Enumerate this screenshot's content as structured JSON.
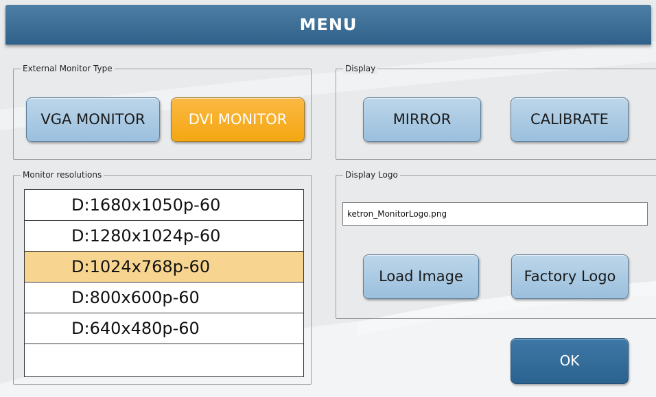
{
  "header": {
    "title": "MENU"
  },
  "external_monitor": {
    "legend": "External Monitor Type",
    "vga_label": "VGA MONITOR",
    "dvi_label": "DVI MONITOR",
    "selected": "DVI MONITOR"
  },
  "display": {
    "legend": "Display",
    "mirror_label": "MIRROR",
    "calibrate_label": "CALIBRATE"
  },
  "resolutions": {
    "legend": "Monitor resolutions",
    "items": [
      "D:1680x1050p-60",
      "D:1280x1024p-60",
      "D:1024x768p-60",
      "D:800x600p-60",
      "D:640x480p-60",
      ""
    ],
    "selected": "D:1024x768p-60"
  },
  "display_logo": {
    "legend": "Display Logo",
    "file_value": "ketron_MonitorLogo.png",
    "load_label": "Load Image",
    "factory_label": "Factory Logo"
  },
  "ok_label": "OK",
  "colors": {
    "title_bar": "#2f6089",
    "button": "#a9c9e4",
    "button_active": "#f4a712",
    "row_selected": "#f7d590",
    "ok_button": "#2b628f"
  }
}
